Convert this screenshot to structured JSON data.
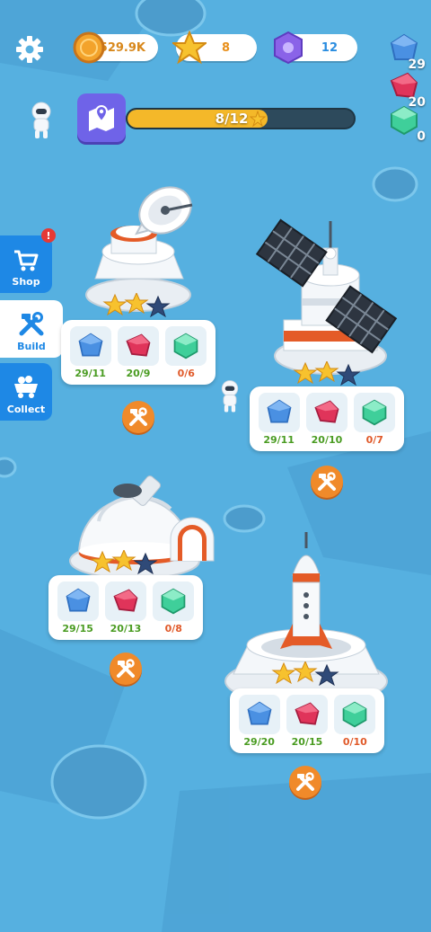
{
  "hud": {
    "coins": "529.9K",
    "stars": "8",
    "gems": "12",
    "progress_text": "8/12",
    "progress_fraction": 0.62
  },
  "resources": [
    {
      "name": "blue-crystal",
      "count": "29",
      "color": "#4a90e2"
    },
    {
      "name": "red-crystal",
      "count": "20",
      "color": "#e0345a"
    },
    {
      "name": "teal-crystal",
      "count": "0",
      "color": "#3fcf9a"
    }
  ],
  "side_menu": {
    "shop_label": "Shop",
    "build_label": "Build",
    "collect_label": "Collect"
  },
  "buildings": [
    {
      "name": "radar-dish",
      "stars": 2,
      "blue": "29/11",
      "red": "20/9",
      "teal": "0/6"
    },
    {
      "name": "solar-station",
      "stars": 2,
      "blue": "29/11",
      "red": "20/10",
      "teal": "0/7"
    },
    {
      "name": "dome-observatory",
      "stars": 2,
      "blue": "29/15",
      "red": "20/13",
      "teal": "0/8"
    },
    {
      "name": "rocket-launchpad",
      "stars": 2,
      "blue": "29/20",
      "red": "20/15",
      "teal": "0/10"
    }
  ],
  "colors": {
    "background": "#56b0e0",
    "progress_fill": "#f4b829",
    "progress_track": "#2d4a5c",
    "accent_orange": "#f08a2a",
    "side_button": "#1e88e5"
  }
}
